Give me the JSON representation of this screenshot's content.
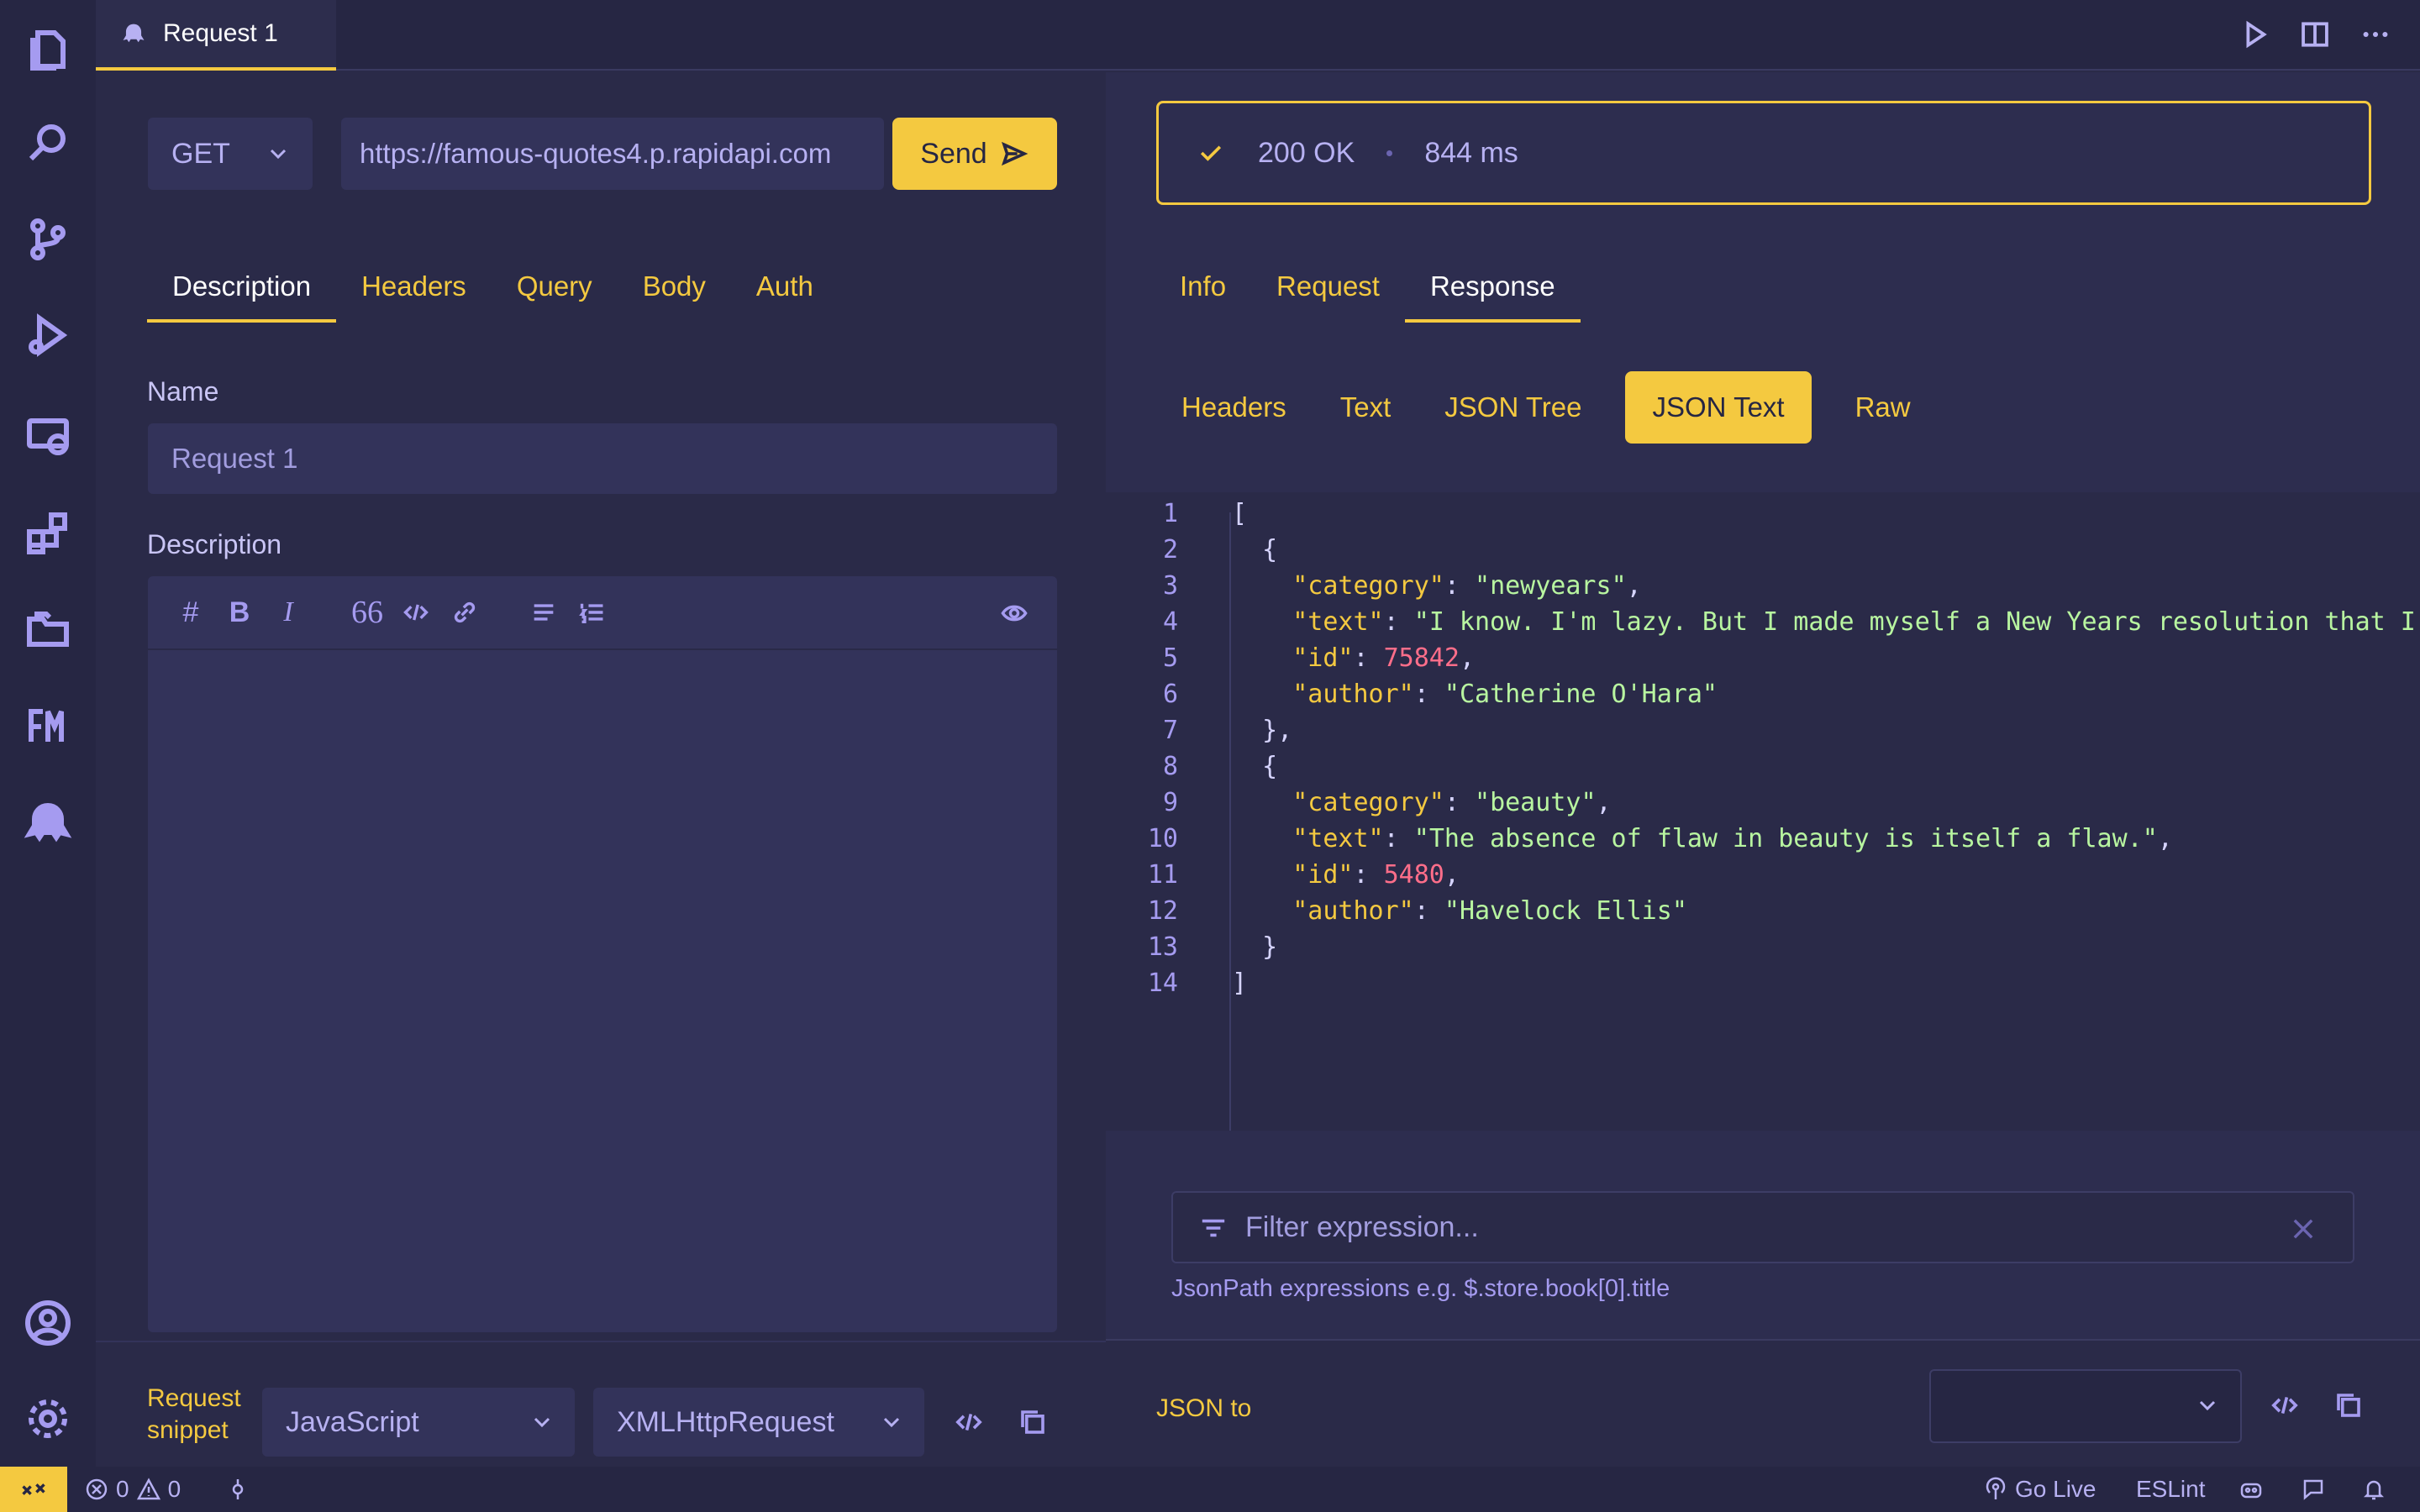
{
  "tab": {
    "title": "Request 1"
  },
  "request": {
    "method": "GET",
    "url": "https://famous-quotes4.p.rapidapi.com",
    "send_label": "Send",
    "tabs": [
      "Description",
      "Headers",
      "Query",
      "Body",
      "Auth"
    ],
    "name_label": "Name",
    "name_value": "Request 1",
    "description_label": "Description"
  },
  "snippet": {
    "label": "Request snippet",
    "language": "JavaScript",
    "library": "XMLHttpRequest"
  },
  "response": {
    "status": "200 OK",
    "time": "844 ms",
    "tabs": [
      "Info",
      "Request",
      "Response"
    ],
    "view_tabs": [
      "Headers",
      "Text",
      "JSON Tree",
      "JSON Text",
      "Raw"
    ],
    "filter_placeholder": "Filter expression...",
    "filter_hint": "JsonPath expressions e.g. $.store.book[0].title",
    "json_to_label": "JSON to"
  },
  "code_lines": [
    "1",
    "2",
    "3",
    "4",
    "5",
    "6",
    "7",
    "8",
    "9",
    "10",
    "11",
    "12",
    "13",
    "14"
  ],
  "json": {
    "items": [
      {
        "category": "newyears",
        "text": "I know. I'm lazy. But I made myself a New Years resolution that I wou",
        "id": "75842",
        "author": "Catherine O'Hara"
      },
      {
        "category": "beauty",
        "text": "The absence of flaw in beauty is itself a flaw.",
        "id": "5480",
        "author": "Havelock Ellis"
      }
    ]
  },
  "statusbar": {
    "errors": "0",
    "warnings": "0",
    "go_live": "Go Live",
    "eslint": "ESLint"
  },
  "colors": {
    "accent": "#f4c940",
    "background": "#2a2a48",
    "string": "#b8f5a0",
    "number": "#ff6e8a"
  }
}
